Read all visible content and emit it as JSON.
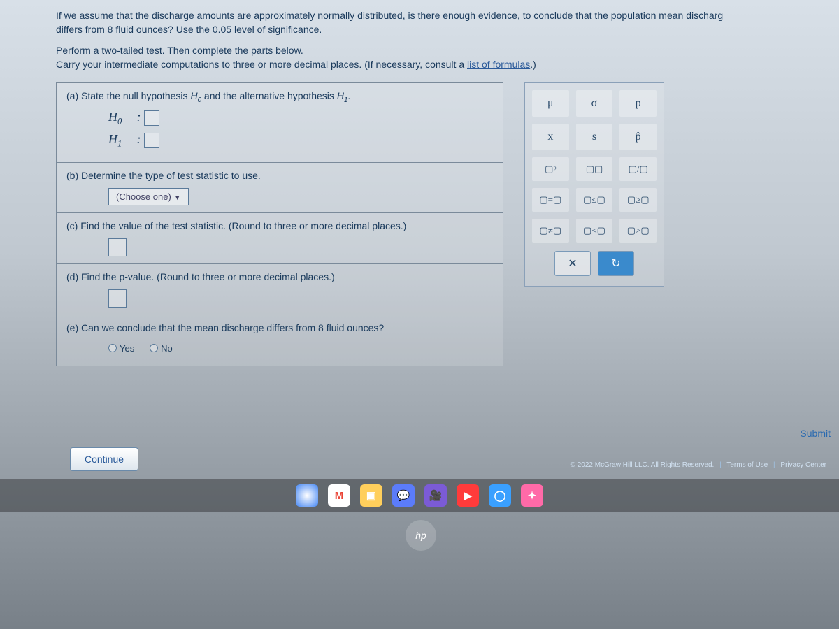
{
  "prompt": {
    "line1_partial": "If we assume that the discharge amounts are approximately normally distributed, is there enough evidence, to conclude that the population mean discharg",
    "line2": "differs from 8 fluid ounces? Use the 0.05 level of significance.",
    "line3": "Perform a two-tailed test. Then complete the parts below.",
    "line4_pre": "Carry your intermediate computations to three or more decimal places. (If necessary, consult a ",
    "line4_link": "list of formulas",
    "line4_post": ".)"
  },
  "parts": {
    "a": {
      "text_pre": "(a)  State the null hypothesis ",
      "h0": "H",
      "h0_sub": "0",
      "mid": " and the alternative hypothesis ",
      "h1": "H",
      "h1_sub": "1",
      "post": ".",
      "row_h0_label": "H",
      "row_h0_sub": "0",
      "row_h1_label": "H",
      "row_h1_sub": "1",
      "colon": " :"
    },
    "b": {
      "text": "(b)  Determine the type of test statistic to use.",
      "dropdown": "(Choose one)"
    },
    "c": {
      "text": "(c)  Find the value of the test statistic. (Round to three or more decimal places.)"
    },
    "d": {
      "text": "(d)  Find the p-value. (Round to three or more decimal places.)"
    },
    "e": {
      "text": "(e)  Can we conclude that the mean discharge differs from 8 fluid ounces?",
      "opt_yes": "Yes",
      "opt_no": "No"
    }
  },
  "palette": {
    "r1": [
      "μ",
      "σ",
      "p"
    ],
    "r2": [
      "x̄",
      "s",
      "p̂"
    ],
    "r3": [
      "▢ᵖ",
      "▢▢",
      "▢/▢"
    ],
    "r4": [
      "▢=▢",
      "▢≤▢",
      "▢≥▢"
    ],
    "r5": [
      "▢≠▢",
      "▢<▢",
      "▢>▢"
    ],
    "clear": "✕",
    "reset": "↻"
  },
  "footer": {
    "continue": "Continue",
    "submit": "Submit",
    "copyright": "© 2022 McGraw Hill LLC. All Rights Reserved.",
    "terms": "Terms of Use",
    "privacy": "Privacy Center"
  },
  "taskbar": {
    "icons": [
      "chrome",
      "gmail",
      "files",
      "chat",
      "video",
      "youtube",
      "app1",
      "app2"
    ],
    "hp": "hp"
  }
}
